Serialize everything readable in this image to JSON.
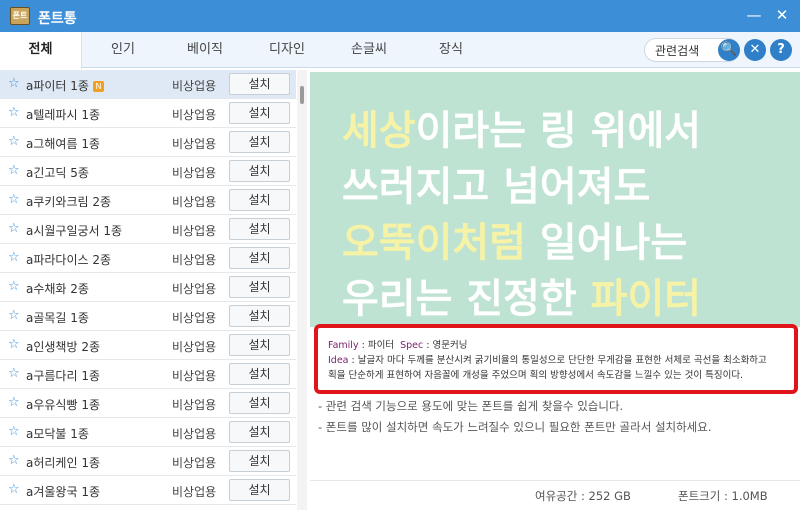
{
  "window": {
    "title": "폰트통",
    "icon_text": "폰트"
  },
  "window_controls": {
    "minimize": "—",
    "close": "✕"
  },
  "tabs": [
    {
      "label": "전체"
    },
    {
      "label": "인기"
    },
    {
      "label": "베이직"
    },
    {
      "label": "디자인"
    },
    {
      "label": "손글씨"
    },
    {
      "label": "장식"
    }
  ],
  "search": {
    "value": "관련검색",
    "search_glyph": "🔍",
    "clear_glyph": "✕",
    "help_glyph": "?"
  },
  "new_badge": "N",
  "fonts": [
    {
      "name": "a파이터 1종",
      "license": "비상업용",
      "action": "설치"
    },
    {
      "name": "a텔레파시 1종",
      "license": "비상업용",
      "action": "설치"
    },
    {
      "name": "a그해여름 1종",
      "license": "비상업용",
      "action": "설치"
    },
    {
      "name": "a긴고딕 5종",
      "license": "비상업용",
      "action": "설치"
    },
    {
      "name": "a쿠키와크림 2종",
      "license": "비상업용",
      "action": "설치"
    },
    {
      "name": "a시월구일궁서 1종",
      "license": "비상업용",
      "action": "설치"
    },
    {
      "name": "a파라다이스 2종",
      "license": "비상업용",
      "action": "설치"
    },
    {
      "name": "a수채화 2종",
      "license": "비상업용",
      "action": "설치"
    },
    {
      "name": "a골목길 1종",
      "license": "비상업용",
      "action": "설치"
    },
    {
      "name": "a인생책방 2종",
      "license": "비상업용",
      "action": "설치"
    },
    {
      "name": "a구름다리 1종",
      "license": "비상업용",
      "action": "설치"
    },
    {
      "name": "a우유식빵 1종",
      "license": "비상업용",
      "action": "설치"
    },
    {
      "name": "a모닥불 1종",
      "license": "비상업용",
      "action": "설치"
    },
    {
      "name": "a허리케인 1종",
      "license": "비상업용",
      "action": "설치"
    },
    {
      "name": "a겨울왕국 1종",
      "license": "비상업용",
      "action": "설치"
    }
  ],
  "preview": {
    "line1_hl": "세상",
    "line1_rest": "이라는 링 위에서",
    "line2": "쓰러지고 넘어져도",
    "line3_hl": "오뚝이처럼",
    "line3_rest": " 일어나는",
    "line4_rest": "우리는 진정한 ",
    "line4_hl": "파이터",
    "bg_color": "#bfe3d3",
    "highlight_color": "#f6f3a6"
  },
  "info": {
    "family_label": "Family",
    "family_value": "파이터",
    "spec_label": "Spec",
    "spec_value": "영문커닝",
    "idea_label": "Idea",
    "idea_text": "날글자 마다 두께를 분산시켜 굵기비율의 통일성으로 단단한 무게감을 표현한 서체로 곡선을 최소화하고",
    "idea_text2": "획을 단순하게 표현하여 자음꼴에 개성을 주었으며 획의 방향성에서 속도감을 느낄수 있는 것이 특징이다."
  },
  "tips": [
    "- 관련 검색 기능으로 용도에 맞는 폰트를 쉽게 찾을수 있습니다.",
    "- 폰트를 많이 설치하면 속도가 느려질수 있으니 필요한 폰트만 골라서 설치하세요."
  ],
  "footer": {
    "free_space": "여유공간 :  252 GB",
    "font_size": "폰트크기 :  1.0MB"
  },
  "colors": {
    "title_bar": "#3c8fd6",
    "accent": "#2f7fc9",
    "highlight_border": "#e0151c"
  }
}
